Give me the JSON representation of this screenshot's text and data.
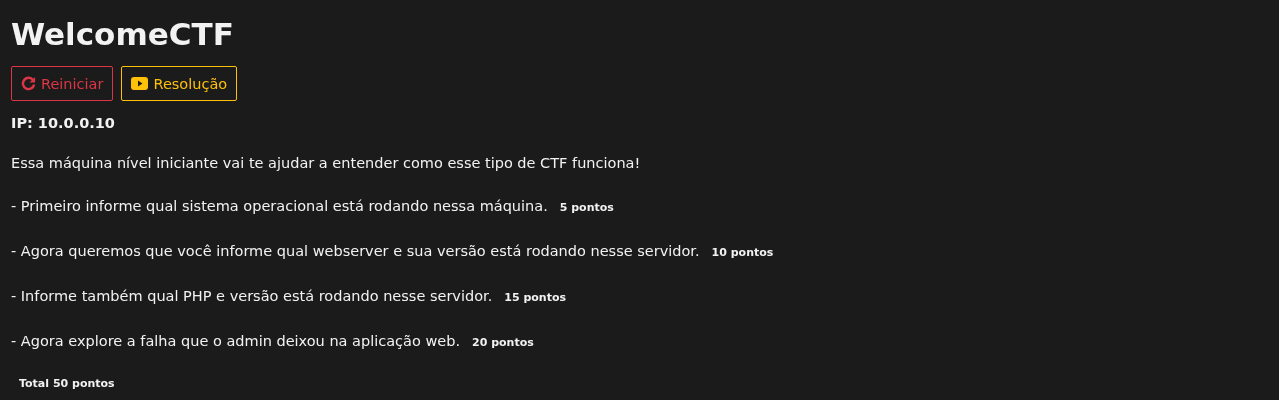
{
  "title": "WelcomeCTF",
  "buttons": [
    {
      "kind": "restart",
      "label": "Reiniciar"
    },
    {
      "kind": "video",
      "label": "Resolução"
    }
  ],
  "ip": "IP: 10.0.0.10",
  "intro": "Essa máquina nível iniciante vai te ajudar a entender como esse tipo de CTF funciona!",
  "tasks": [
    {
      "text": "- Primeiro informe qual sistema operacional está rodando nessa máquina.",
      "points": "5 pontos"
    },
    {
      "text": "- Agora queremos que você informe qual webserver e sua versão está rodando nesse servidor.",
      "points": "10 pontos"
    },
    {
      "text": "- Informe também qual PHP e versão está rodando nesse servidor.",
      "points": "15 pontos"
    },
    {
      "text": "- Agora explore a falha que o admin deixou na aplicação web.",
      "points": "20 pontos"
    }
  ],
  "total": "Total 50 pontos"
}
